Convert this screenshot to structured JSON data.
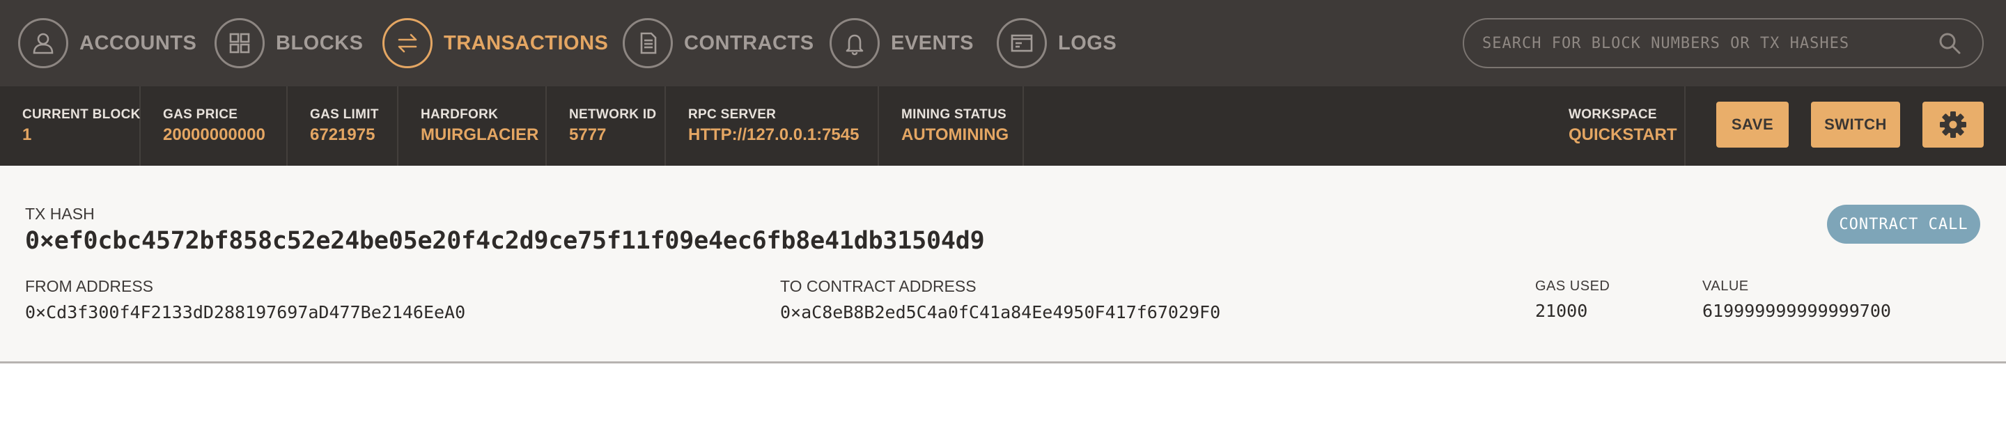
{
  "nav": {
    "items": [
      {
        "label": "ACCOUNTS",
        "icon": "person-icon",
        "active": false
      },
      {
        "label": "BLOCKS",
        "icon": "grid-icon",
        "active": false
      },
      {
        "label": "TRANSACTIONS",
        "icon": "arrows-swap-icon",
        "active": true
      },
      {
        "label": "CONTRACTS",
        "icon": "document-icon",
        "active": false
      },
      {
        "label": "EVENTS",
        "icon": "bell-icon",
        "active": false
      },
      {
        "label": "LOGS",
        "icon": "terminal-icon",
        "active": false
      }
    ],
    "search_placeholder": "SEARCH FOR BLOCK NUMBERS OR TX HASHES"
  },
  "status": {
    "current_block": {
      "label": "CURRENT BLOCK",
      "value": "1"
    },
    "gas_price": {
      "label": "GAS PRICE",
      "value": "20000000000"
    },
    "gas_limit": {
      "label": "GAS LIMIT",
      "value": "6721975"
    },
    "hardfork": {
      "label": "HARDFORK",
      "value": "MUIRGLACIER"
    },
    "network_id": {
      "label": "NETWORK ID",
      "value": "5777"
    },
    "rpc_server": {
      "label": "RPC SERVER",
      "value": "HTTP://127.0.0.1:7545"
    },
    "mining_status": {
      "label": "MINING STATUS",
      "value": "AUTOMINING"
    },
    "workspace": {
      "label": "WORKSPACE",
      "value": "QUICKSTART"
    },
    "save_label": "SAVE",
    "switch_label": "SWITCH",
    "settings_icon": "gear-icon"
  },
  "transaction": {
    "hash_label": "TX HASH",
    "hash": "0×ef0cbc4572bf858c52e24be05e20f4c2d9ce75f11f09e4ec6fb8e41db31504d9",
    "type_badge": "CONTRACT CALL",
    "from_label": "FROM ADDRESS",
    "from": "0×Cd3f300f4F2133dD288197697aD477Be2146EeA0",
    "to_label": "TO CONTRACT ADDRESS",
    "to": "0×aC8eB8B2ed5C4a0fC41a84Ee4950F417f67029F0",
    "gas_used_label": "GAS USED",
    "gas_used": "21000",
    "value_label": "VALUE",
    "value": "619999999999999700"
  },
  "colors": {
    "nav_bg": "#3e3a38",
    "status_bg": "#312e2c",
    "accent": "#e4a663",
    "badge": "#7ea5b8",
    "panel_bg": "#f8f7f5"
  }
}
